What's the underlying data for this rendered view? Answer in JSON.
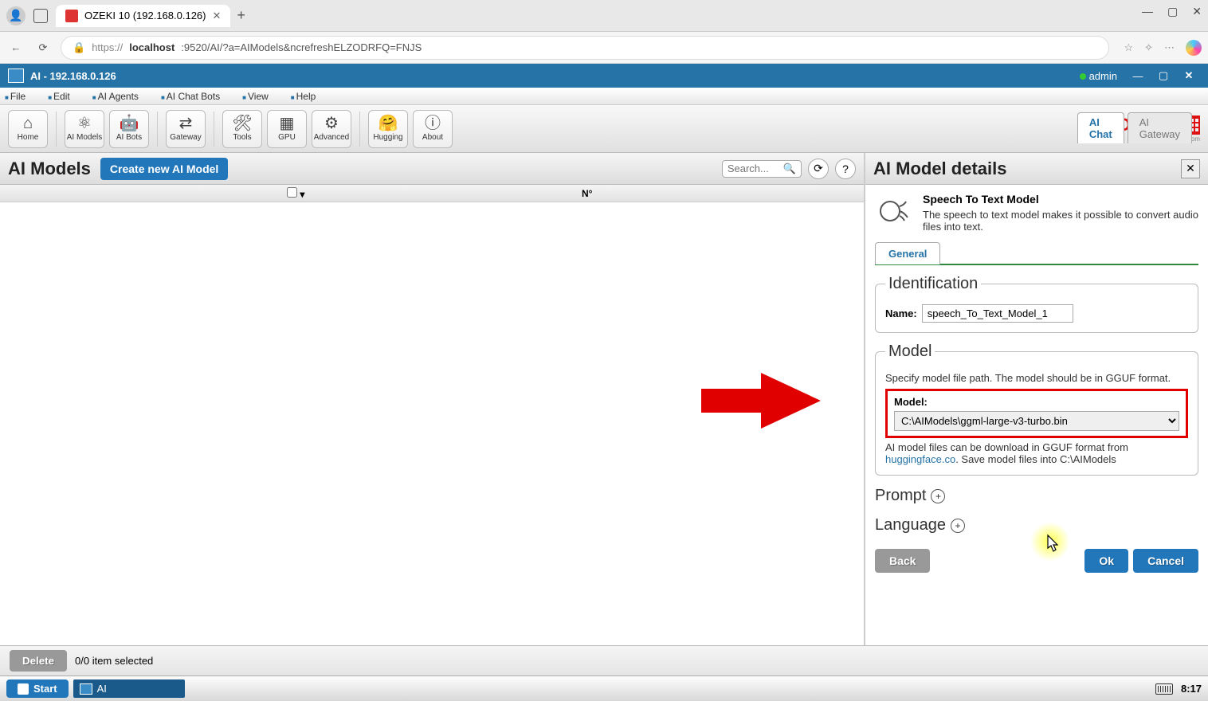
{
  "browser": {
    "tab_title": "OZEKI 10 (192.168.0.126)",
    "url_pre": "https://",
    "url_host": "localhost",
    "url_rest": ":9520/AI/?a=AIModels&ncrefreshELZODRFQ=FNJS"
  },
  "app": {
    "title": "AI - 192.168.0.126",
    "user": "admin"
  },
  "menubar": [
    "File",
    "Edit",
    "AI Agents",
    "AI Chat Bots",
    "View",
    "Help"
  ],
  "toolbar": {
    "home": "Home",
    "aimodels": "AI Models",
    "aibots": "AI Bots",
    "gateway": "Gateway",
    "tools": "Tools",
    "gpu": "GPU",
    "advanced": "Advanced",
    "hugging": "Hugging",
    "about": "About"
  },
  "right_tabs": {
    "chat": "AI Chat",
    "gateway": "AI Gateway"
  },
  "ozeki_sub": "www.myozeki.com",
  "main": {
    "title": "AI Models",
    "create_btn": "Create new AI Model",
    "search_placeholder": "Search...",
    "col_no": "N°"
  },
  "bottom": {
    "delete": "Delete",
    "selection": "0/0 item selected"
  },
  "details": {
    "title": "AI Model details",
    "model_title": "Speech To Text Model",
    "model_desc": "The speech to text model makes it possible to convert audio files into text.",
    "tab_general": "General",
    "leg_ident": "Identification",
    "name_label": "Name:",
    "name_value": "speech_To_Text_Model_1",
    "leg_model": "Model",
    "model_hint": "Specify model file path. The model should be in GGUF format.",
    "model_label": "Model:",
    "model_value": "C:\\AIModels\\ggml-large-v3-turbo.bin",
    "dl_pre": "AI model files can be download in GGUF format from ",
    "dl_link": "huggingface.co",
    "dl_post": ". Save model files into C:\\AIModels",
    "prompt": "Prompt",
    "language": "Language",
    "btn_back": "Back",
    "btn_ok": "Ok",
    "btn_cancel": "Cancel"
  },
  "taskbar": {
    "start": "Start",
    "app": "AI",
    "time": "8:17"
  }
}
